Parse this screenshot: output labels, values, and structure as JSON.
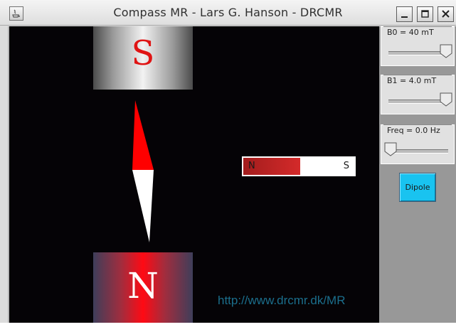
{
  "window": {
    "title": "Compass MR - Lars G. Hanson - DRCMR",
    "controls": [
      "minimize",
      "maximize",
      "close"
    ]
  },
  "canvas": {
    "top_magnet_label": "S",
    "bottom_magnet_label": "N",
    "bar_magnet": {
      "left_label": "N",
      "right_label": "S"
    },
    "url": "http://www.drcmr.dk/MR"
  },
  "controls": {
    "b0": {
      "label": "B0 = 40 mT",
      "value_fraction": 1.0
    },
    "b1": {
      "label": "B1 = 4.0 mT",
      "value_fraction": 1.0
    },
    "freq": {
      "label": "Freq = 0.0 Hz",
      "value_fraction": 0.0
    },
    "dipole_button": "Dipole"
  },
  "colors": {
    "canvas_background": "#050306",
    "needle_north": "#ff0000",
    "needle_south": "#ffffff",
    "url_text": "#1b6e8c",
    "dipole_button": "#19c3f0",
    "bar_magnet_north": "#c62828"
  },
  "icons": [
    "java-app-icon",
    "minimize-icon",
    "maximize-icon",
    "close-icon",
    "slider-thumb-icon"
  ]
}
